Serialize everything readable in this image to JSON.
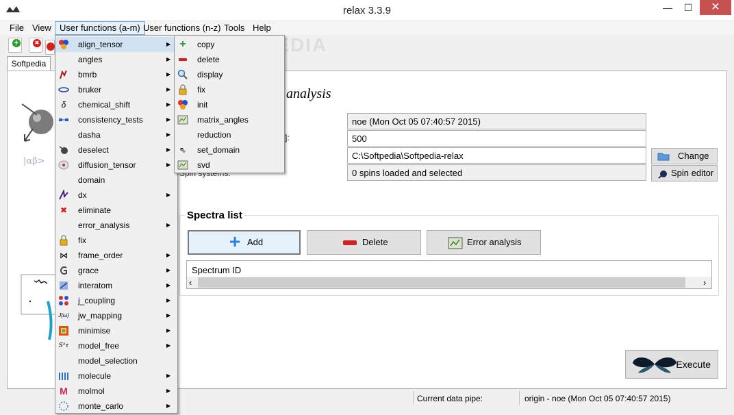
{
  "window": {
    "title": "relax 3.3.9",
    "minimize": "—",
    "maximize": "☐",
    "close": "✕"
  },
  "menubar": {
    "file": "File",
    "view": "View",
    "user_am": "User functions (a-m)",
    "user_nz": "User functions (n-z)",
    "tools": "Tools",
    "help": "Help"
  },
  "tab": {
    "label": "Softpedia"
  },
  "analysis": {
    "title_fragment": "analysis"
  },
  "fields": {
    "pipe_value": "noe (Mon Oct 05 07:40:57 2015)",
    "frequency_label_fragment": "]:",
    "frequency_value": "500",
    "results_dir_value": "C:\\Softpedia\\Softpedia-relax",
    "spin_systems_label": "Spin systems:",
    "spin_systems_value": "0 spins loaded and selected"
  },
  "buttons": {
    "change": "Change",
    "spin_editor": "Spin editor",
    "add": "Add",
    "delete": "Delete",
    "error_analysis": "Error analysis",
    "execute": "Execute"
  },
  "spectra": {
    "title": "Spectra list",
    "column_header": "Spectrum ID"
  },
  "statusbar": {
    "pipe_label": "Current data pipe:",
    "pipe_value": "origin - noe (Mon Oct 05 07:40:57 2015)"
  },
  "menu_am": {
    "items": [
      {
        "label": "align_tensor",
        "arrow": "▶"
      },
      {
        "label": "angles",
        "arrow": "▶"
      },
      {
        "label": "bmrb",
        "arrow": "▶"
      },
      {
        "label": "bruker",
        "arrow": "▶"
      },
      {
        "label": "chemical_shift",
        "arrow": "▶"
      },
      {
        "label": "consistency_tests",
        "arrow": "▶"
      },
      {
        "label": "dasha",
        "arrow": "▶"
      },
      {
        "label": "deselect",
        "arrow": "▶"
      },
      {
        "label": "diffusion_tensor",
        "arrow": "▶"
      },
      {
        "label": "domain",
        "arrow": ""
      },
      {
        "label": "dx",
        "arrow": "▶"
      },
      {
        "label": "eliminate",
        "arrow": ""
      },
      {
        "label": "error_analysis",
        "arrow": "▶"
      },
      {
        "label": "fix",
        "arrow": ""
      },
      {
        "label": "frame_order",
        "arrow": "▶"
      },
      {
        "label": "grace",
        "arrow": "▶"
      },
      {
        "label": "interatom",
        "arrow": "▶"
      },
      {
        "label": "j_coupling",
        "arrow": "▶"
      },
      {
        "label": "jw_mapping",
        "arrow": "▶"
      },
      {
        "label": "minimise",
        "arrow": "▶"
      },
      {
        "label": "model_free",
        "arrow": "▶"
      },
      {
        "label": "model_selection",
        "arrow": ""
      },
      {
        "label": "molecule",
        "arrow": "▶"
      },
      {
        "label": "molmol",
        "arrow": "▶"
      },
      {
        "label": "monte_carlo",
        "arrow": "▶"
      }
    ]
  },
  "menu_align": {
    "items": [
      {
        "label": "copy"
      },
      {
        "label": "delete"
      },
      {
        "label": "display"
      },
      {
        "label": "fix"
      },
      {
        "label": "init"
      },
      {
        "label": "matrix_angles"
      },
      {
        "label": "reduction"
      },
      {
        "label": "set_domain"
      },
      {
        "label": "svd"
      }
    ]
  },
  "icons": {
    "plus": "+",
    "minus": "—",
    "cross": "✖",
    "submenu_arrow": "▶",
    "cursor": "⇖",
    "scroll_left": "‹",
    "scroll_right": "›",
    "bowtie": "⋈",
    "delta": "δ",
    "lock": "🔒"
  },
  "watermark": "SOFTPEDIA",
  "colors": {
    "accent": "#3c8be0",
    "highlight": "#d1e2f2",
    "close": "#c75050"
  }
}
